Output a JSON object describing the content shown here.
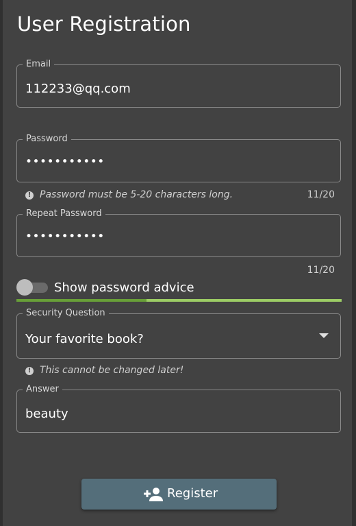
{
  "form": {
    "title": "User Registration",
    "email": {
      "label": "Email",
      "value": "112233@qq.com"
    },
    "password": {
      "label": "Password",
      "value": "•••••••••••",
      "hint": "Password must be 5-20 characters long.",
      "counter": "11/20"
    },
    "repeat_password": {
      "label": "Repeat Password",
      "value": "•••••••••••",
      "counter": "11/20"
    },
    "show_advice": {
      "label": "Show password advice",
      "checked": false
    },
    "password_strength": {
      "fraction": 0.4,
      "color_strong": "#689f38",
      "color_track": "#9ccc65"
    },
    "security_question": {
      "label": "Security Question",
      "value": "Your favorite book?",
      "hint": "This cannot be changed later!",
      "arrow_icon": "dropdown-arrow-icon"
    },
    "answer": {
      "label": "Answer",
      "value": "beauty"
    },
    "register": {
      "label": "Register",
      "icon": "person-add-icon",
      "color": "#546e7a"
    }
  }
}
